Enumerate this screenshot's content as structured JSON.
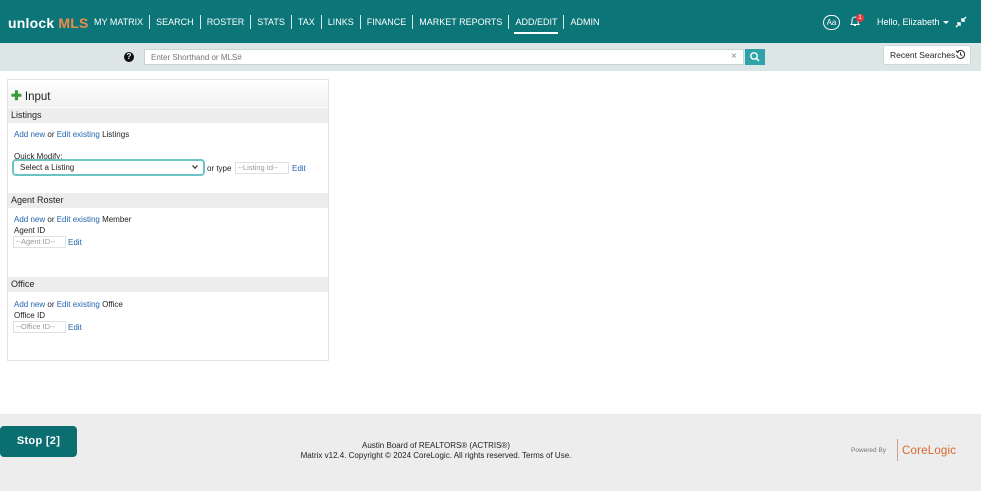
{
  "app": {
    "logo_main": "unlock",
    "logo_accent": "MLS"
  },
  "nav": {
    "items": [
      "MY MATRIX",
      "SEARCH",
      "ROSTER",
      "STATS",
      "TAX",
      "LINKS",
      "FINANCE",
      "MARKET REPORTS",
      "ADD/EDIT",
      "ADMIN"
    ],
    "active": "ADD/EDIT"
  },
  "header": {
    "font_toggle": "Aa",
    "notification_count": "1",
    "greeting": "Hello, Elizabeth"
  },
  "search": {
    "help": "?",
    "placeholder": "Enter Shorthand or MLS#",
    "clear": "×",
    "recent_label": "Recent Searches"
  },
  "panel": {
    "title": "Input",
    "listings": {
      "header": "Listings",
      "add_new": "Add new",
      "or": " or ",
      "edit_existing": "Edit existing",
      "suffix": " Listings",
      "quick_modify": "Quick Modify:",
      "select_value": "Select a Listing",
      "or_type": "or type",
      "id_placeholder": "--Listing Id--",
      "edit": "Edit"
    },
    "roster": {
      "header": "Agent Roster",
      "add_new": "Add new",
      "or": " or ",
      "edit_existing": "Edit existing",
      "suffix": " Member",
      "id_label": "Agent ID",
      "id_placeholder": "--Agent ID--",
      "edit": "Edit"
    },
    "office": {
      "header": "Office",
      "add_new": "Add new",
      "or": " or ",
      "edit_existing": "Edit existing",
      "suffix": " Office",
      "id_label": "Office ID",
      "id_placeholder": "--Office ID--",
      "edit": "Edit"
    }
  },
  "footer": {
    "stop_label": "Stop [2]",
    "board": "Austin Board of REALTORS® (ACTRIS®)",
    "copyright": "Matrix v12.4. Copyright © 2024 CoreLogic. All rights reserved.",
    "terms": "Terms of Use.",
    "powered_by": "Powered By",
    "brand": "CoreLogic"
  },
  "colors": {
    "nav_bg": "#0b7578",
    "accent": "#f08a4b",
    "search_button": "#2fa3a8",
    "link": "#2166b0"
  }
}
